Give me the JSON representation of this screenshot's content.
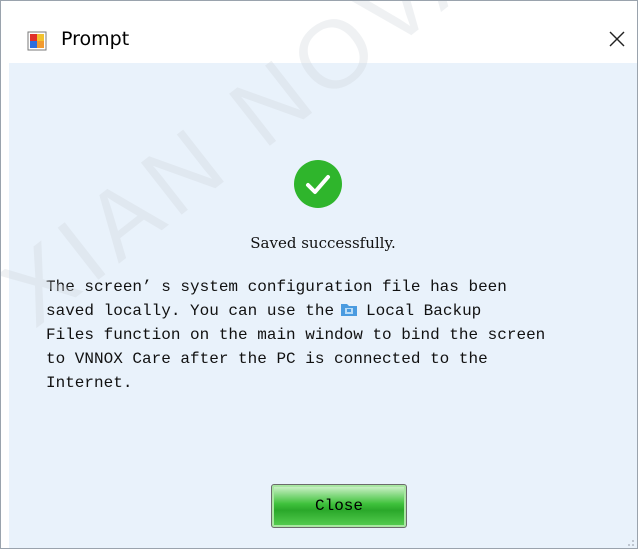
{
  "window": {
    "title": "Prompt",
    "close_glyph": "✕"
  },
  "dialog": {
    "status_icon": "success-check-icon",
    "status_color": "#2fb52c",
    "message_title": "Saved successfully.",
    "message_lines": [
      "The screen’ s system configuration file has been",
      "saved locally. You can use the",
      "Local Backup",
      "Files function on the main window to bind the screen",
      "to VNNOX Care after the PC is connected to the",
      "Internet."
    ],
    "inline_icon": "local-backup-folder-icon",
    "close_button_label": "Close"
  },
  "watermark_text": "XIAN NOVA",
  "colors": {
    "client_background": "#e9f2fb",
    "button_green": "#3ec13b"
  }
}
